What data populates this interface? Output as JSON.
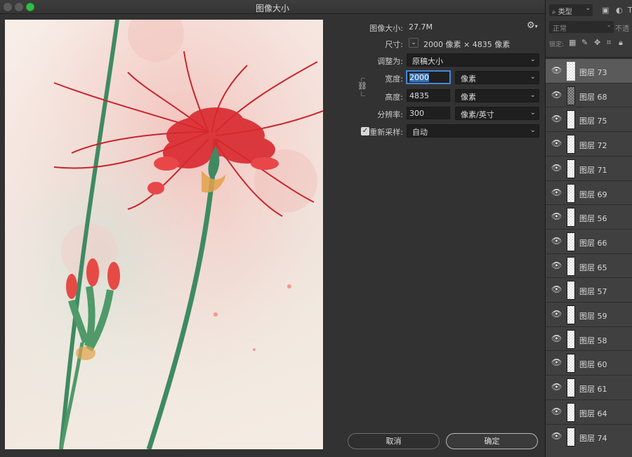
{
  "window": {
    "title": "图像大小"
  },
  "form": {
    "image_size_label": "图像大小:",
    "image_size_value": "27.7M",
    "dimensions_label": "尺寸:",
    "dimensions_value": "2000 像素 × 4835 像素",
    "fit_to_label": "调整为:",
    "fit_to_value": "原稿大小",
    "width_label": "宽度:",
    "width_value": "2000",
    "width_unit": "像素",
    "height_label": "高度:",
    "height_value": "4835",
    "height_unit": "像素",
    "resolution_label": "分辨率:",
    "resolution_value": "300",
    "resolution_unit": "像素/英寸",
    "resample_label": "重新采样:",
    "resample_checked": true,
    "resample_value": "自动"
  },
  "buttons": {
    "cancel": "取消",
    "ok": "确定"
  },
  "layers_panel": {
    "kind_filter": "类型",
    "blend_mode": "正常",
    "opacity_label": "不透",
    "lock_label": "锁定:",
    "layers": [
      {
        "name": "图层 73",
        "selected": true
      },
      {
        "name": "图层 68",
        "selected": false
      },
      {
        "name": "图层 75",
        "selected": false
      },
      {
        "name": "图层 72",
        "selected": false
      },
      {
        "name": "图层 71",
        "selected": false
      },
      {
        "name": "图层 69",
        "selected": false
      },
      {
        "name": "图层 56",
        "selected": false
      },
      {
        "name": "图层 66",
        "selected": false
      },
      {
        "name": "图层 65",
        "selected": false
      },
      {
        "name": "图层 57",
        "selected": false
      },
      {
        "name": "图层 59",
        "selected": false
      },
      {
        "name": "图层 58",
        "selected": false
      },
      {
        "name": "图层 60",
        "selected": false
      },
      {
        "name": "图层 61",
        "selected": false
      },
      {
        "name": "图层 64",
        "selected": false
      },
      {
        "name": "图层 74",
        "selected": false
      }
    ]
  }
}
